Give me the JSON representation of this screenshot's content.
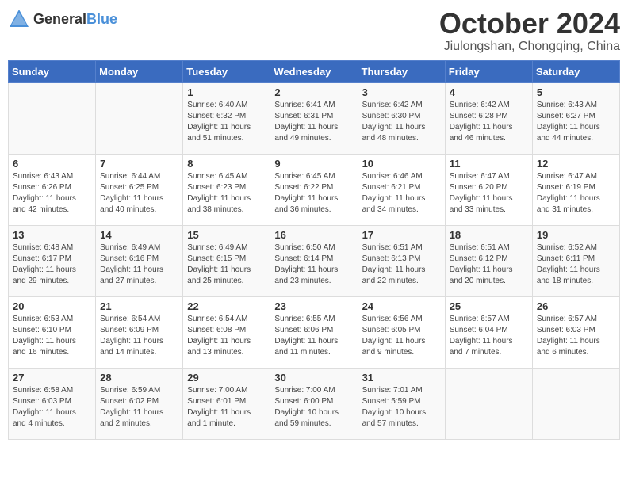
{
  "header": {
    "logo_general": "General",
    "logo_blue": "Blue",
    "month_title": "October 2024",
    "location": "Jiulongshan, Chongqing, China"
  },
  "weekdays": [
    "Sunday",
    "Monday",
    "Tuesday",
    "Wednesday",
    "Thursday",
    "Friday",
    "Saturday"
  ],
  "weeks": [
    [
      {
        "day": "",
        "sunrise": "",
        "sunset": "",
        "daylight": ""
      },
      {
        "day": "",
        "sunrise": "",
        "sunset": "",
        "daylight": ""
      },
      {
        "day": "1",
        "sunrise": "Sunrise: 6:40 AM",
        "sunset": "Sunset: 6:32 PM",
        "daylight": "Daylight: 11 hours and 51 minutes."
      },
      {
        "day": "2",
        "sunrise": "Sunrise: 6:41 AM",
        "sunset": "Sunset: 6:31 PM",
        "daylight": "Daylight: 11 hours and 49 minutes."
      },
      {
        "day": "3",
        "sunrise": "Sunrise: 6:42 AM",
        "sunset": "Sunset: 6:30 PM",
        "daylight": "Daylight: 11 hours and 48 minutes."
      },
      {
        "day": "4",
        "sunrise": "Sunrise: 6:42 AM",
        "sunset": "Sunset: 6:28 PM",
        "daylight": "Daylight: 11 hours and 46 minutes."
      },
      {
        "day": "5",
        "sunrise": "Sunrise: 6:43 AM",
        "sunset": "Sunset: 6:27 PM",
        "daylight": "Daylight: 11 hours and 44 minutes."
      }
    ],
    [
      {
        "day": "6",
        "sunrise": "Sunrise: 6:43 AM",
        "sunset": "Sunset: 6:26 PM",
        "daylight": "Daylight: 11 hours and 42 minutes."
      },
      {
        "day": "7",
        "sunrise": "Sunrise: 6:44 AM",
        "sunset": "Sunset: 6:25 PM",
        "daylight": "Daylight: 11 hours and 40 minutes."
      },
      {
        "day": "8",
        "sunrise": "Sunrise: 6:45 AM",
        "sunset": "Sunset: 6:23 PM",
        "daylight": "Daylight: 11 hours and 38 minutes."
      },
      {
        "day": "9",
        "sunrise": "Sunrise: 6:45 AM",
        "sunset": "Sunset: 6:22 PM",
        "daylight": "Daylight: 11 hours and 36 minutes."
      },
      {
        "day": "10",
        "sunrise": "Sunrise: 6:46 AM",
        "sunset": "Sunset: 6:21 PM",
        "daylight": "Daylight: 11 hours and 34 minutes."
      },
      {
        "day": "11",
        "sunrise": "Sunrise: 6:47 AM",
        "sunset": "Sunset: 6:20 PM",
        "daylight": "Daylight: 11 hours and 33 minutes."
      },
      {
        "day": "12",
        "sunrise": "Sunrise: 6:47 AM",
        "sunset": "Sunset: 6:19 PM",
        "daylight": "Daylight: 11 hours and 31 minutes."
      }
    ],
    [
      {
        "day": "13",
        "sunrise": "Sunrise: 6:48 AM",
        "sunset": "Sunset: 6:17 PM",
        "daylight": "Daylight: 11 hours and 29 minutes."
      },
      {
        "day": "14",
        "sunrise": "Sunrise: 6:49 AM",
        "sunset": "Sunset: 6:16 PM",
        "daylight": "Daylight: 11 hours and 27 minutes."
      },
      {
        "day": "15",
        "sunrise": "Sunrise: 6:49 AM",
        "sunset": "Sunset: 6:15 PM",
        "daylight": "Daylight: 11 hours and 25 minutes."
      },
      {
        "day": "16",
        "sunrise": "Sunrise: 6:50 AM",
        "sunset": "Sunset: 6:14 PM",
        "daylight": "Daylight: 11 hours and 23 minutes."
      },
      {
        "day": "17",
        "sunrise": "Sunrise: 6:51 AM",
        "sunset": "Sunset: 6:13 PM",
        "daylight": "Daylight: 11 hours and 22 minutes."
      },
      {
        "day": "18",
        "sunrise": "Sunrise: 6:51 AM",
        "sunset": "Sunset: 6:12 PM",
        "daylight": "Daylight: 11 hours and 20 minutes."
      },
      {
        "day": "19",
        "sunrise": "Sunrise: 6:52 AM",
        "sunset": "Sunset: 6:11 PM",
        "daylight": "Daylight: 11 hours and 18 minutes."
      }
    ],
    [
      {
        "day": "20",
        "sunrise": "Sunrise: 6:53 AM",
        "sunset": "Sunset: 6:10 PM",
        "daylight": "Daylight: 11 hours and 16 minutes."
      },
      {
        "day": "21",
        "sunrise": "Sunrise: 6:54 AM",
        "sunset": "Sunset: 6:09 PM",
        "daylight": "Daylight: 11 hours and 14 minutes."
      },
      {
        "day": "22",
        "sunrise": "Sunrise: 6:54 AM",
        "sunset": "Sunset: 6:08 PM",
        "daylight": "Daylight: 11 hours and 13 minutes."
      },
      {
        "day": "23",
        "sunrise": "Sunrise: 6:55 AM",
        "sunset": "Sunset: 6:06 PM",
        "daylight": "Daylight: 11 hours and 11 minutes."
      },
      {
        "day": "24",
        "sunrise": "Sunrise: 6:56 AM",
        "sunset": "Sunset: 6:05 PM",
        "daylight": "Daylight: 11 hours and 9 minutes."
      },
      {
        "day": "25",
        "sunrise": "Sunrise: 6:57 AM",
        "sunset": "Sunset: 6:04 PM",
        "daylight": "Daylight: 11 hours and 7 minutes."
      },
      {
        "day": "26",
        "sunrise": "Sunrise: 6:57 AM",
        "sunset": "Sunset: 6:03 PM",
        "daylight": "Daylight: 11 hours and 6 minutes."
      }
    ],
    [
      {
        "day": "27",
        "sunrise": "Sunrise: 6:58 AM",
        "sunset": "Sunset: 6:03 PM",
        "daylight": "Daylight: 11 hours and 4 minutes."
      },
      {
        "day": "28",
        "sunrise": "Sunrise: 6:59 AM",
        "sunset": "Sunset: 6:02 PM",
        "daylight": "Daylight: 11 hours and 2 minutes."
      },
      {
        "day": "29",
        "sunrise": "Sunrise: 7:00 AM",
        "sunset": "Sunset: 6:01 PM",
        "daylight": "Daylight: 11 hours and 1 minute."
      },
      {
        "day": "30",
        "sunrise": "Sunrise: 7:00 AM",
        "sunset": "Sunset: 6:00 PM",
        "daylight": "Daylight: 10 hours and 59 minutes."
      },
      {
        "day": "31",
        "sunrise": "Sunrise: 7:01 AM",
        "sunset": "Sunset: 5:59 PM",
        "daylight": "Daylight: 10 hours and 57 minutes."
      },
      {
        "day": "",
        "sunrise": "",
        "sunset": "",
        "daylight": ""
      },
      {
        "day": "",
        "sunrise": "",
        "sunset": "",
        "daylight": ""
      }
    ]
  ]
}
